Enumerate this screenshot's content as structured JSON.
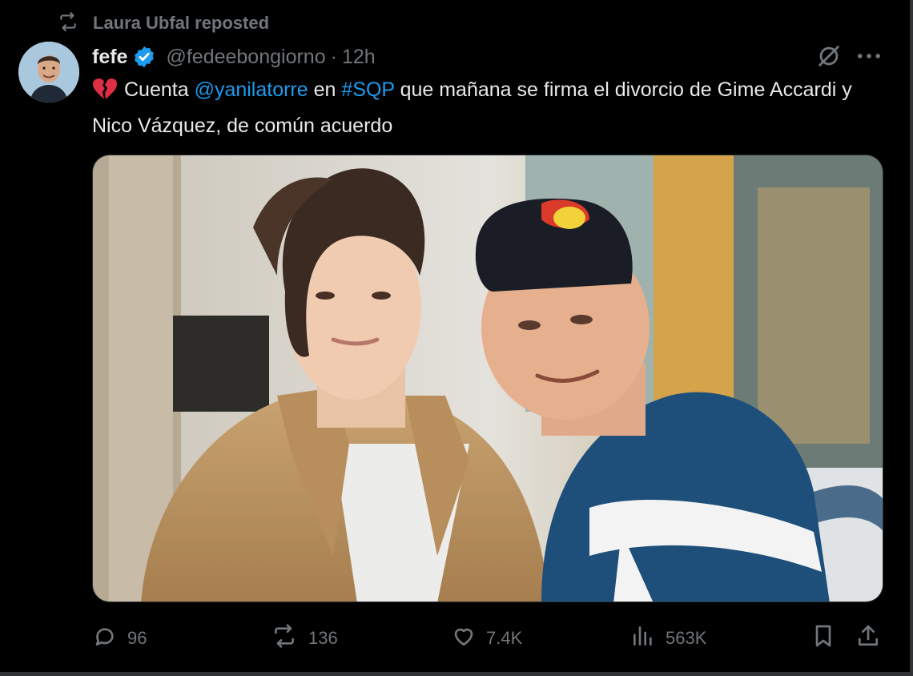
{
  "repost": {
    "icon": "repost-icon",
    "text": "Laura Ubfal reposted"
  },
  "author": {
    "name": "fefe",
    "handle": "@fedeebongiorno",
    "separator": "·",
    "time": "12h",
    "verified_color": "#1d9bf0"
  },
  "tweet": {
    "emoji": "broken-heart-icon",
    "text_1": "Cuenta ",
    "mention": "@yanilatorre",
    "text_2": " en ",
    "hashtag": "#SQP",
    "text_3": " que mañana se firma el divorcio de Gime Accardi y Nico Vázquez, de común acuerdo"
  },
  "actions": {
    "replies": "96",
    "reposts": "136",
    "likes": "7.4K",
    "views": "563K"
  },
  "colors": {
    "background": "#000000",
    "text": "#e7e9ea",
    "muted": "#71767b",
    "link": "#1d9bf0"
  }
}
